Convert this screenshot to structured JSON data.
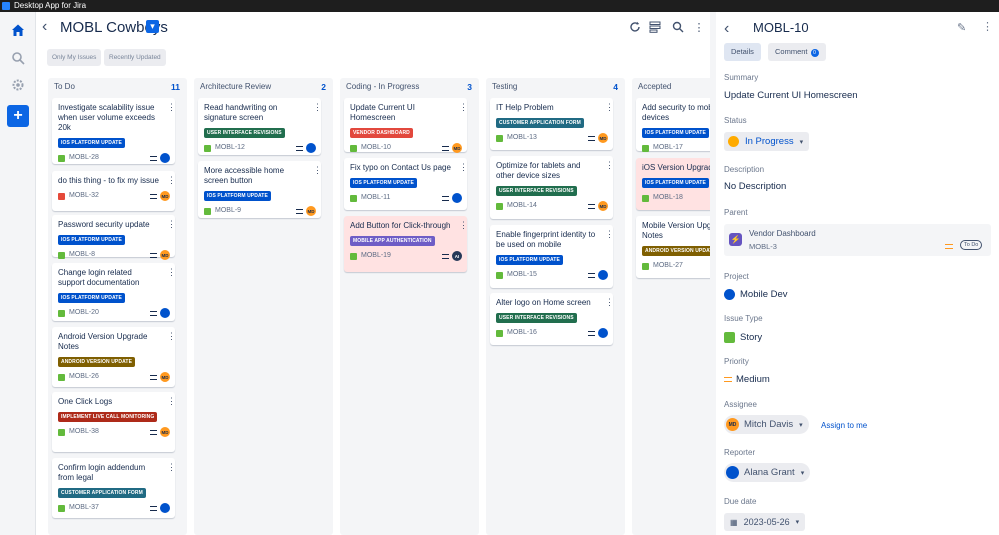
{
  "window_title": "Desktop App for Jira",
  "project": {
    "title": "MOBL Cowboys"
  },
  "filters": {
    "only_my_issues": "Only My Issues",
    "recently_updated": "Recently Updated"
  },
  "columns": [
    {
      "name": "To Do",
      "count": "11",
      "cards": [
        {
          "title": "Investigate scalability issue when user volume exceeds 20k",
          "epic": "IOS PLATFORM UPDATE",
          "epic_color": "#0052cc",
          "key": "MOBL-28",
          "type": "story",
          "avatar": "AG"
        },
        {
          "title": "do this thing - to fix my issue",
          "epic": "",
          "epic_color": "",
          "key": "MOBL-32",
          "type": "bug",
          "avatar": "MD"
        },
        {
          "title": "Password security update",
          "epic": "IOS PLATFORM UPDATE",
          "epic_color": "#0052cc",
          "key": "MOBL-8",
          "type": "story",
          "avatar": "MD"
        },
        {
          "title": "Change login related support documentation",
          "epic": "IOS PLATFORM UPDATE",
          "epic_color": "#0052cc",
          "key": "MOBL-20",
          "type": "story",
          "avatar": "AG"
        },
        {
          "title": "Android Version Upgrade Notes",
          "epic": "ANDROID VERSION UPDATE",
          "epic_color": "#7f5f01",
          "key": "MOBL-26",
          "type": "story",
          "avatar": "MD"
        },
        {
          "title": "One Click Logs",
          "epic": "IMPLEMENT LIVE CALL MONITORING",
          "epic_color": "#ae2a19",
          "key": "MOBL-38",
          "type": "story",
          "avatar": "MD"
        },
        {
          "title": "Confirm login addendum from legal",
          "epic": "CUSTOMER APPLICATION FORM",
          "epic_color": "#206a83",
          "key": "MOBL-37",
          "type": "story",
          "avatar": "AG"
        }
      ]
    },
    {
      "name": "Architecture Review",
      "count": "2",
      "cards": [
        {
          "title": "Read handwriting on signature screen",
          "epic": "USER INTERFACE REVISIONS",
          "epic_color": "#216e4e",
          "key": "MOBL-12",
          "type": "story",
          "avatar": "AG"
        },
        {
          "title": "More accessible home screen button",
          "epic": "IOS PLATFORM UPDATE",
          "epic_color": "#0052cc",
          "key": "MOBL-9",
          "type": "story",
          "avatar": "MD"
        }
      ]
    },
    {
      "name": "Coding - In Progress",
      "count": "3",
      "cards": [
        {
          "title": "Update Current UI Homescreen",
          "epic": "VENDOR DASHBOARD",
          "epic_color": "#e2483d",
          "key": "MOBL-10",
          "type": "story",
          "avatar": "MD"
        },
        {
          "title": "Fix typo on Contact Us page",
          "epic": "IOS PLATFORM UPDATE",
          "epic_color": "#0052cc",
          "key": "MOBL-11",
          "type": "story",
          "avatar": "AG"
        },
        {
          "title": "Add Button for Click-through",
          "epic": "MOBILE APP AUTHENTICATION",
          "epic_color": "#6e5dc6",
          "key": "MOBL-19",
          "type": "story",
          "avatar": "AI",
          "flagged": true
        }
      ]
    },
    {
      "name": "Testing",
      "count": "4",
      "cards": [
        {
          "title": "IT Help Problem",
          "epic": "CUSTOMER APPLICATION FORM",
          "epic_color": "#206a83",
          "key": "MOBL-13",
          "type": "story",
          "avatar": "MD"
        },
        {
          "title": "Optimize for tablets and other device sizes",
          "epic": "USER INTERFACE REVISIONS",
          "epic_color": "#216e4e",
          "key": "MOBL-14",
          "type": "story",
          "avatar": "MD"
        },
        {
          "title": "Enable fingerprint identity to be used on mobile",
          "epic": "IOS PLATFORM UPDATE",
          "epic_color": "#0052cc",
          "key": "MOBL-15",
          "type": "story",
          "avatar": "AG"
        },
        {
          "title": "Alter logo on Home screen",
          "epic": "USER INTERFACE REVISIONS",
          "epic_color": "#216e4e",
          "key": "MOBL-16",
          "type": "story",
          "avatar": "AG"
        }
      ]
    },
    {
      "name": "Accepted",
      "count": "",
      "cards": [
        {
          "title": "Add security to mobile devices",
          "epic": "IOS PLATFORM UPDATE",
          "epic_color": "#0052cc",
          "key": "MOBL-17",
          "type": "story",
          "avatar": ""
        },
        {
          "title": "iOS Version Upgrade",
          "epic": "IOS PLATFORM UPDATE",
          "epic_color": "#0052cc",
          "key": "MOBL-18",
          "type": "story",
          "avatar": "",
          "flagged": true
        },
        {
          "title": "Mobile Version Upgrade Notes",
          "epic": "ANDROID VERSION UPDATE",
          "epic_color": "#7f5f01",
          "key": "MOBL-27",
          "type": "story",
          "avatar": ""
        }
      ]
    }
  ],
  "detail": {
    "key": "MOBL-10",
    "tabs": {
      "details": "Details",
      "comment": "Comment",
      "comment_count": "0"
    },
    "summary_label": "Summary",
    "summary": "Update Current UI Homescreen",
    "status_label": "Status",
    "status": "In Progress",
    "description_label": "Description",
    "description": "No Description",
    "parent_label": "Parent",
    "parent_name": "Vendor Dashboard",
    "parent_key": "MOBL-3",
    "parent_status": "To Do",
    "project_label": "Project",
    "project": "Mobile Dev",
    "issue_type_label": "Issue Type",
    "issue_type": "Story",
    "priority_label": "Priority",
    "priority": "Medium",
    "assignee_label": "Assignee",
    "assignee": "Mitch Davis",
    "assign_to_me": "Assign to me",
    "reporter_label": "Reporter",
    "reporter": "Alana Grant",
    "due_date_label": "Due date",
    "due_date": "2023-05-26"
  },
  "colors": {
    "accent": "#0c66e4",
    "story": "#63ba3c",
    "bug": "#e5493a",
    "flagged": "#ffe2e2"
  }
}
